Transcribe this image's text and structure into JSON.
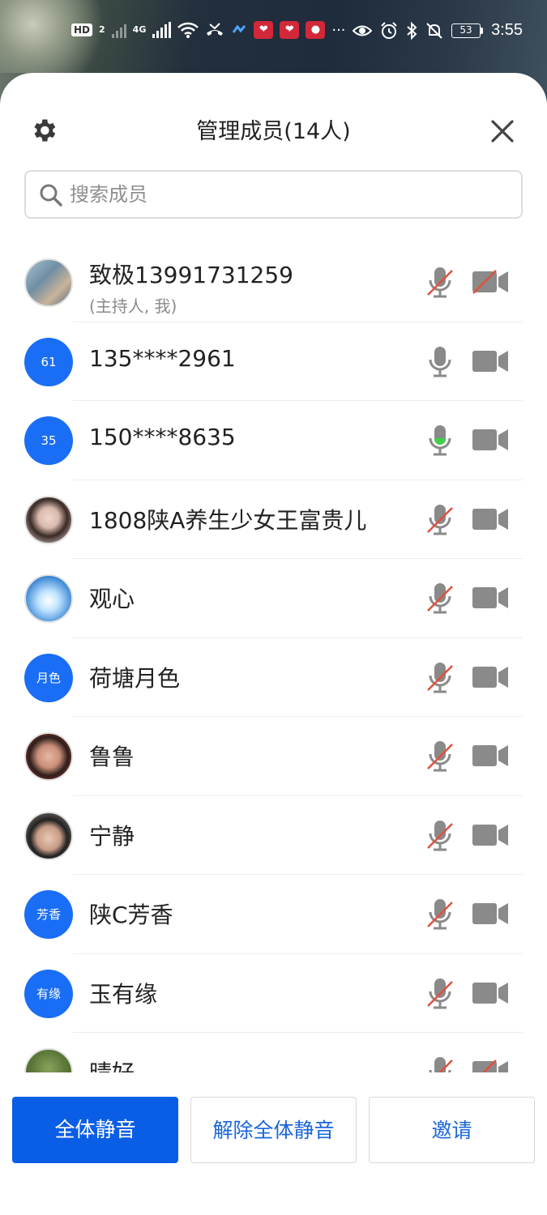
{
  "status_bar": {
    "hd_label": "HD",
    "sim2_label": "2",
    "net_label": "4G",
    "battery_level": "53",
    "time": "3:55",
    "more_label": "···"
  },
  "header": {
    "title": "管理成员(14人)"
  },
  "search": {
    "placeholder": "搜索成员",
    "value": ""
  },
  "members": [
    {
      "name": "致极13991731259",
      "subtitle": "(主持人, 我)",
      "avatar_type": "photo",
      "avatar_text": "",
      "mic": "muted",
      "camera": "off"
    },
    {
      "name": "135****2961",
      "avatar_type": "initials",
      "avatar_text": "61",
      "mic": "on",
      "camera": "on"
    },
    {
      "name": "150****8635",
      "avatar_type": "initials",
      "avatar_text": "35",
      "mic": "speaking",
      "camera": "on"
    },
    {
      "name": "1808陕A养生少女王富贵儿",
      "avatar_type": "photo",
      "avatar_text": "",
      "mic": "muted",
      "camera": "on"
    },
    {
      "name": "观心",
      "avatar_type": "photo",
      "avatar_text": "",
      "mic": "muted",
      "camera": "on"
    },
    {
      "name": "荷塘月色",
      "avatar_type": "initials",
      "avatar_text": "月色",
      "mic": "muted",
      "camera": "on"
    },
    {
      "name": "鲁鲁",
      "avatar_type": "photo",
      "avatar_text": "",
      "mic": "muted",
      "camera": "on"
    },
    {
      "name": "宁静",
      "avatar_type": "photo",
      "avatar_text": "",
      "mic": "muted",
      "camera": "on"
    },
    {
      "name": "陕C芳香",
      "avatar_type": "initials",
      "avatar_text": "芳香",
      "mic": "muted",
      "camera": "on"
    },
    {
      "name": "玉有缘",
      "avatar_type": "initials",
      "avatar_text": "有缘",
      "mic": "muted",
      "camera": "on"
    },
    {
      "name": "晴好",
      "avatar_type": "photo",
      "avatar_text": "",
      "mic": "muted",
      "camera": "off"
    }
  ],
  "footer": {
    "mute_all": "全体静音",
    "unmute_all": "解除全体静音",
    "invite": "邀请"
  },
  "colors": {
    "accent_blue": "#0a5ee6",
    "avatar_blue": "#1a6ef5",
    "icon_gray": "#8a8a8a",
    "muted_red": "#e0503c",
    "speaking_green": "#3fd14a"
  }
}
